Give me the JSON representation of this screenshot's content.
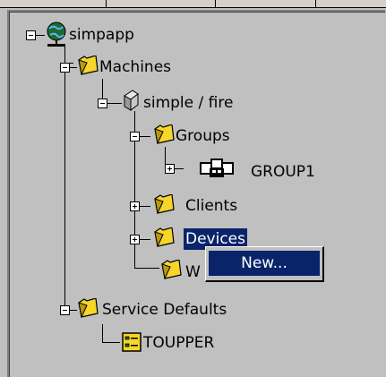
{
  "tree": {
    "root": {
      "label": "simpapp",
      "icon": "globe-network-icon"
    },
    "machines": {
      "label": "Machines",
      "icon": "folder-icon"
    },
    "machine": {
      "label": "simple / fire",
      "icon": "computer-icon"
    },
    "groups": {
      "label": "Groups",
      "icon": "folder-icon"
    },
    "group1": {
      "label": "GROUP1",
      "icon": "group-servers-icon"
    },
    "clients": {
      "label": "Clients",
      "icon": "folder-icon"
    },
    "devices": {
      "label": "Devices",
      "icon": "folder-icon",
      "selected": true
    },
    "w_folder": {
      "label": "W",
      "icon": "folder-icon"
    },
    "service_defaults": {
      "label": "Service Defaults",
      "icon": "folder-icon"
    },
    "toupper": {
      "label": "TOUPPER",
      "icon": "service-icon"
    }
  },
  "context_menu": {
    "items": [
      {
        "label": "New..."
      }
    ]
  },
  "colors": {
    "background": "#c0c0c0",
    "selection": "#0a246a",
    "folder": "#f5d629"
  }
}
